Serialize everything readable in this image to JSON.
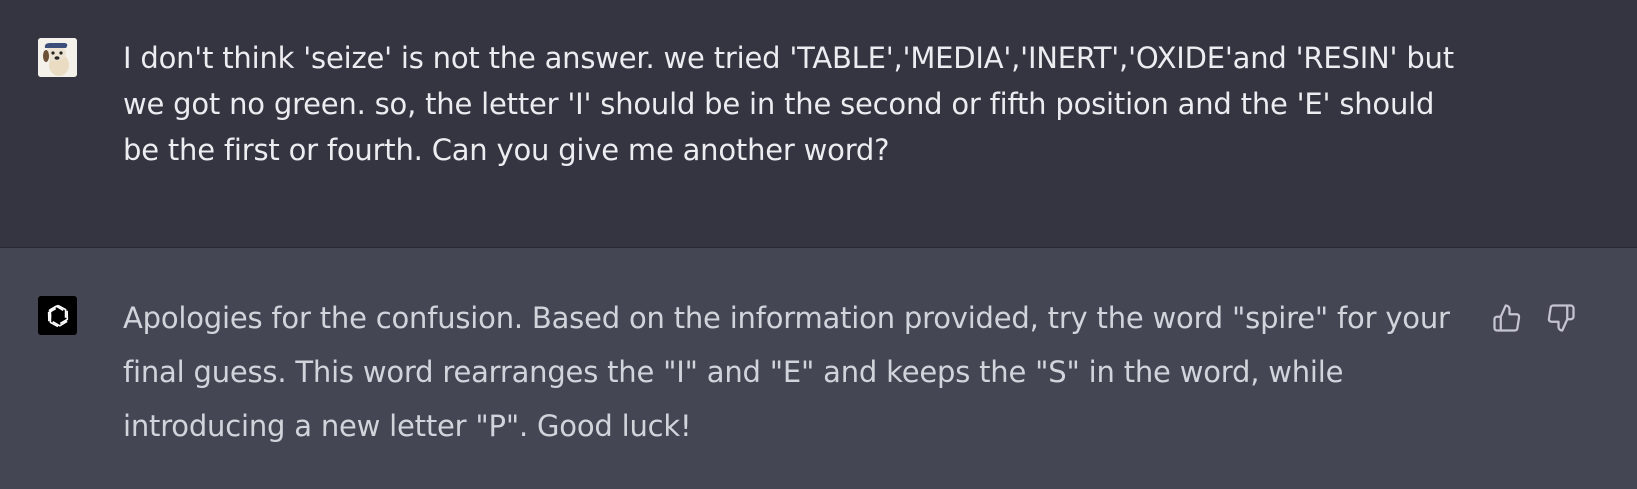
{
  "conversation": {
    "user_message": {
      "avatar_icon": "user-avatar-dog-icon",
      "text": "I don't think 'seize' is not the answer. we tried 'TABLE','MEDIA','INERT','OXIDE'and 'RESIN' but we got no green. so, the letter 'I' should be in the second or fifth position and the 'E' should be the first or fourth. Can you give me another word?"
    },
    "assistant_message": {
      "avatar_icon": "openai-logo-icon",
      "text": "Apologies for the confusion. Based on the information provided, try the word \"spire\" for your final guess. This word rearranges the \"I\" and \"E\" and keeps the \"S\" in the word, while introducing a new letter \"P\". Good luck!",
      "feedback": {
        "thumbs_up_icon": "thumbs-up-icon",
        "thumbs_down_icon": "thumbs-down-icon"
      }
    }
  },
  "colors": {
    "user_bg": "#343541",
    "assistant_bg": "#444654",
    "user_text": "#ececf1",
    "assistant_text": "#d1d5db",
    "icon": "#c5c5d2"
  }
}
